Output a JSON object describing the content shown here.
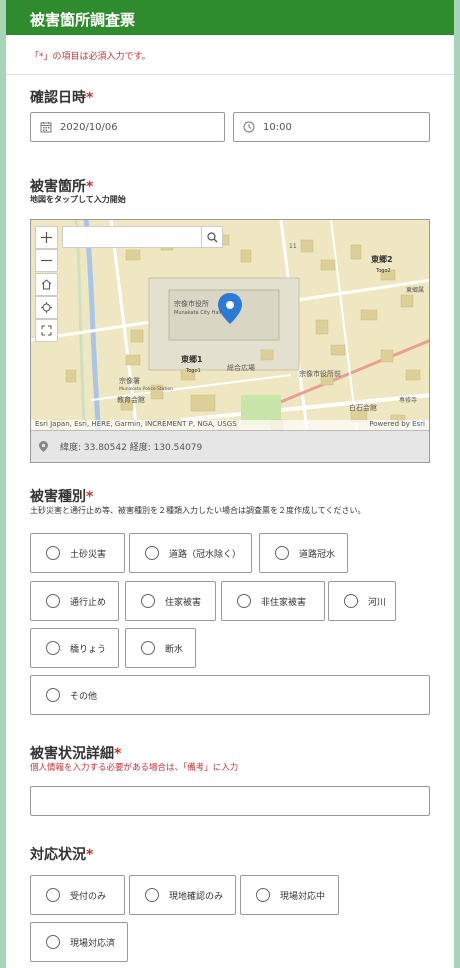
{
  "header": {
    "title": "被害箇所調査票"
  },
  "notice": "「*」の項目は必須入力です。",
  "confirm_datetime": {
    "label": "確認日時",
    "required_mark": "*",
    "date_value": "2020/10/06",
    "time_value": "10:00"
  },
  "location": {
    "label": "被害箇所",
    "required_mark": "*",
    "hint": "地図をタップして入力開始",
    "map": {
      "labels": {
        "city_hall": "宗像市役所",
        "city_hall_en": "Munakata City Hall",
        "togo1": "東郷1",
        "togo1_en": "Togo1",
        "togo2": "東郷2",
        "togo2_en": "Togo2",
        "police": "宗像署",
        "police_en": "Munakata Police Station",
        "education": "教育会館",
        "gym": "総合広場",
        "city_hall_front": "宗像市役所前",
        "park_hall": "白石会館",
        "togo_ward": "東郷属",
        "shrine": "専修寺",
        "num_11": "11"
      },
      "attribution": "Esri Japan, Esri, HERE, Garmin, INCREMENT P, NGA, USGS",
      "powered_by": "Powered by",
      "powered_brand": "Esri",
      "coords_text": "緯度: 33.80542  経度: 130.54079"
    }
  },
  "damage_type": {
    "label": "被害種別",
    "required_mark": "*",
    "hint": "土砂災害と通行止め等、被害種別を２種類入力したい場合は調査票を２度作成してください。",
    "options": [
      "土砂災害",
      "道路（冠水除く）",
      "道路冠水",
      "通行止め",
      "住家被害",
      "非住家被害",
      "河川",
      "橋りょう",
      "断水",
      "その他"
    ]
  },
  "damage_detail": {
    "label": "被害状況詳細",
    "required_mark": "*",
    "hint": "個人情報を入力する必要がある場合は、「備考」に入力",
    "value": ""
  },
  "response_status": {
    "label": "対応状況",
    "required_mark": "*",
    "options": [
      "受付のみ",
      "現地確認のみ",
      "現場対応中",
      "現場対応済"
    ]
  },
  "colors": {
    "header": "#2e8b2e",
    "required": "#d03030",
    "background": "#a8d5b5",
    "map_pin": "#2b7bd6"
  }
}
